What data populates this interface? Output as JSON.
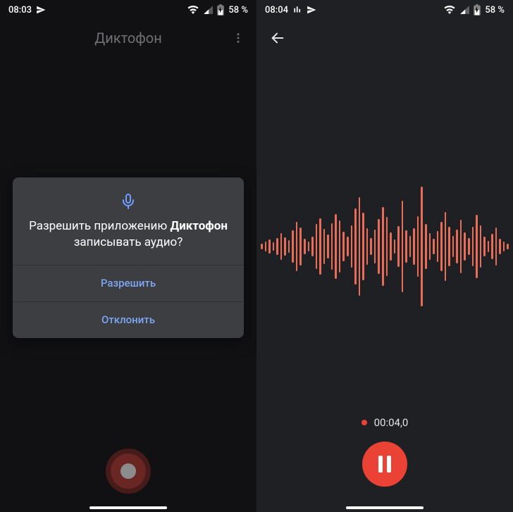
{
  "left": {
    "status": {
      "time": "08:03",
      "battery": "58 %"
    },
    "title": "Диктофон",
    "dialog": {
      "msg_prefix": "Разрешить приложению ",
      "msg_app": "Диктофон",
      "msg_suffix": " записывать аудио?",
      "allow": "Разрешить",
      "deny": "Отклонить"
    }
  },
  "right": {
    "status": {
      "time": "08:04",
      "battery": "58 %"
    },
    "elapsed": "00:04,0",
    "waveform_heights": [
      8,
      14,
      20,
      12,
      24,
      38,
      26,
      18,
      46,
      70,
      54,
      22,
      14,
      28,
      64,
      80,
      50,
      34,
      66,
      92,
      74,
      42,
      28,
      60,
      108,
      140,
      96,
      52,
      24,
      48,
      78,
      112,
      84,
      40,
      20,
      58,
      130,
      46,
      30,
      52,
      86,
      170,
      64,
      38,
      22,
      44,
      70,
      98,
      56,
      30,
      48,
      76,
      40,
      24,
      56,
      90,
      60,
      28,
      16,
      36,
      54,
      22,
      14,
      8
    ]
  },
  "icons": {
    "send": "send-icon",
    "wifi": "wifi-icon",
    "signal": "signal-icon",
    "battery": "battery-icon",
    "overflow": "overflow-icon",
    "mic": "mic-icon",
    "back": "back-icon",
    "equalizer": "equalizer-icon"
  },
  "colors": {
    "accent": "#ea4335",
    "waveform": "#e86e59",
    "link": "#7ea6f4",
    "micIcon": "#6e9eff"
  }
}
